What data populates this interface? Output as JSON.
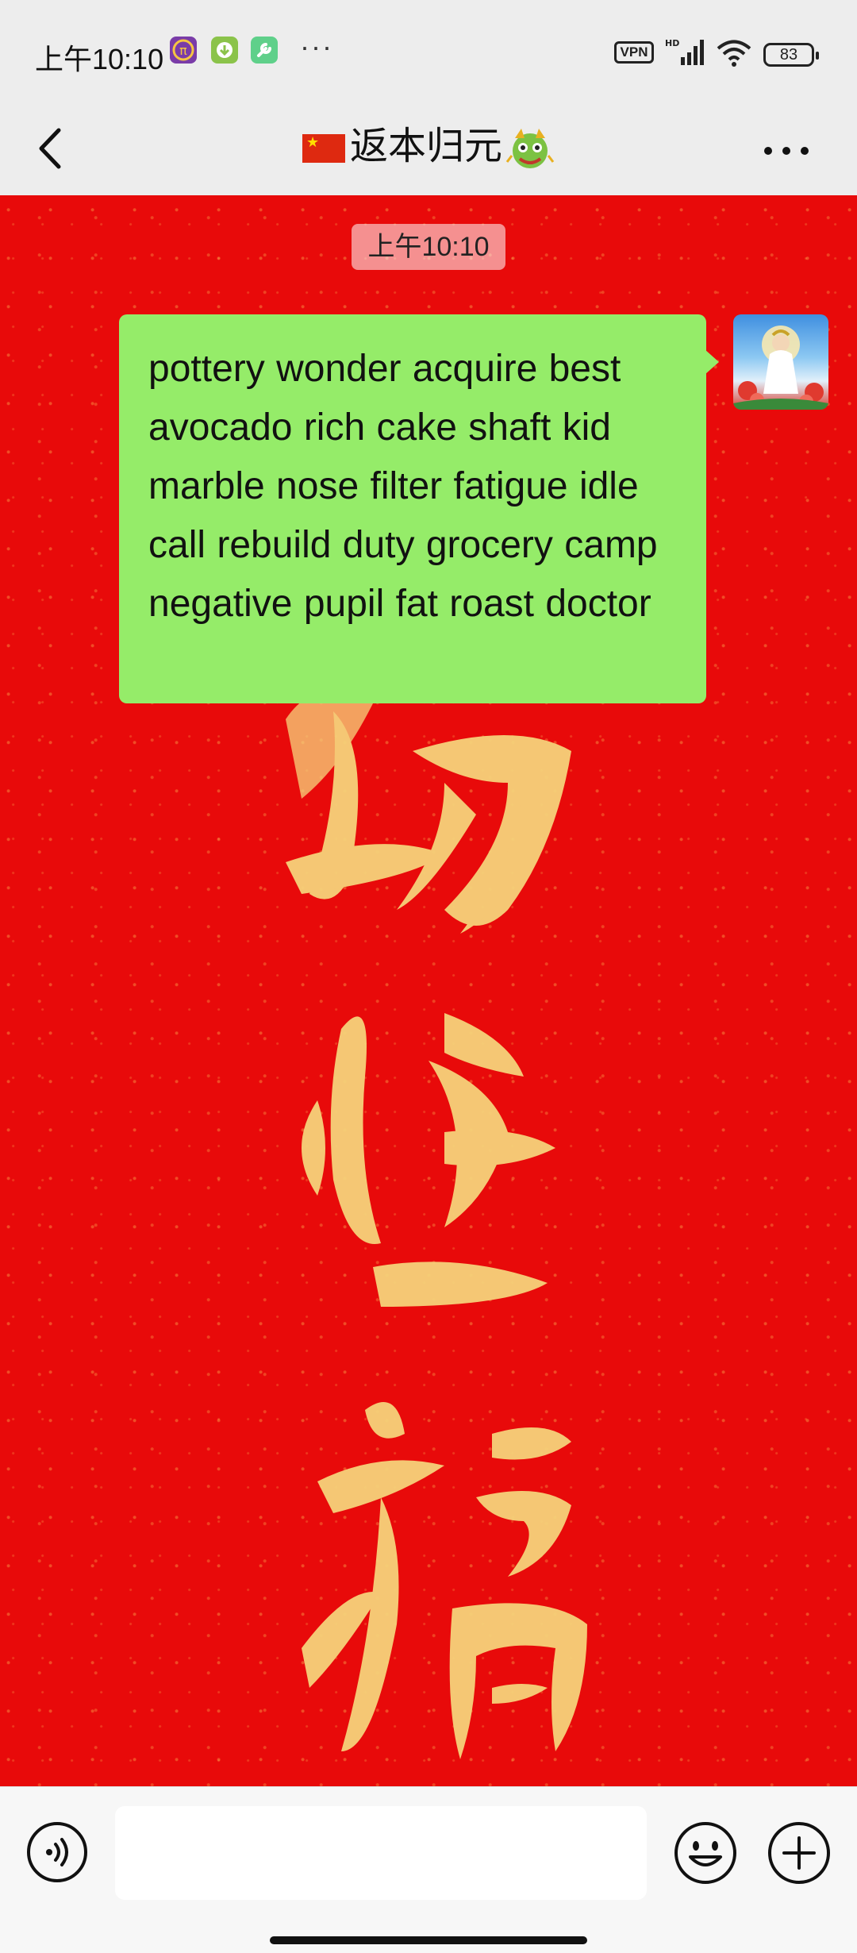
{
  "status_bar": {
    "time": "上午10:10",
    "more_dots": "···",
    "vpn": "VPN",
    "signal_label": "HD",
    "battery": "83",
    "app_colors": [
      "#7a3ca8",
      "#8bc34a",
      "#5fd08a"
    ]
  },
  "header": {
    "title": "返本归元",
    "back_icon": "chevron-left-icon",
    "more_icon": "more-horizontal-icon"
  },
  "chat": {
    "timestamp": "上午10:10",
    "background_color": "#e80a0a",
    "background_calligraphy": "赐鸿福",
    "messages": [
      {
        "sender": "self",
        "text": "pottery wonder acquire best avocado rich cake shaft kid marble nose filter fatigue idle call rebuild duty grocery camp negative pupil fat roast doctor",
        "bubble_color": "#95ec69"
      }
    ]
  },
  "input_bar": {
    "text_value": "",
    "voice_icon": "voice-icon",
    "emoji_icon": "emoji-icon",
    "plus_icon": "plus-icon"
  }
}
